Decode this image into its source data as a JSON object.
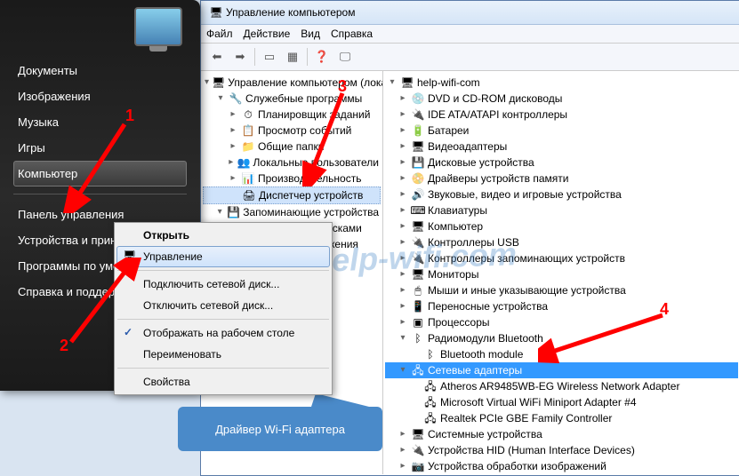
{
  "start_menu": {
    "items": [
      "Документы",
      "Изображения",
      "Музыка",
      "Игры",
      "Компьютер",
      "Панель управления",
      "Устройства и принтеры",
      "Программы по умолчанию",
      "Справка и поддержка"
    ],
    "selected_index": 4,
    "separator_before": [
      5
    ]
  },
  "context_menu": {
    "items": [
      {
        "label": "Открыть",
        "bold": true
      },
      {
        "label": "Управление",
        "highlighted": true,
        "has_icon": true
      },
      {
        "sep": true
      },
      {
        "label": "Подключить сетевой диск..."
      },
      {
        "label": "Отключить сетевой диск..."
      },
      {
        "sep": true
      },
      {
        "label": "Отображать на рабочем столе",
        "checked": true
      },
      {
        "label": "Переименовать"
      },
      {
        "sep": true
      },
      {
        "label": "Свойства"
      }
    ]
  },
  "mgmt": {
    "title": "Управление компьютером",
    "menu": [
      "Файл",
      "Действие",
      "Вид",
      "Справка"
    ],
    "left_tree": [
      {
        "label": "Управление компьютером (локальным)",
        "icon": "🖥",
        "exp": "▾",
        "indent": 0
      },
      {
        "label": "Служебные программы",
        "icon": "🔧",
        "exp": "▾",
        "indent": 1
      },
      {
        "label": "Планировщик заданий",
        "icon": "⏱",
        "exp": "▸",
        "indent": 2
      },
      {
        "label": "Просмотр событий",
        "icon": "📋",
        "exp": "▸",
        "indent": 2
      },
      {
        "label": "Общие папки",
        "icon": "📁",
        "exp": "▸",
        "indent": 2
      },
      {
        "label": "Локальные пользователи",
        "icon": "👥",
        "exp": "▸",
        "indent": 2
      },
      {
        "label": "Производительность",
        "icon": "📊",
        "exp": "▸",
        "indent": 2
      },
      {
        "label": "Диспетчер устройств",
        "icon": "🖨",
        "exp": "",
        "indent": 2,
        "selected": true
      },
      {
        "label": "Запоминающие устройства",
        "icon": "💾",
        "exp": "▾",
        "indent": 1
      },
      {
        "label": "Управление дисками",
        "icon": "💿",
        "exp": "",
        "indent": 2
      },
      {
        "label": "Службы и приложения",
        "icon": "⚙",
        "exp": "▸",
        "indent": 1
      }
    ],
    "right_tree": [
      {
        "label": "help-wifi-com",
        "icon": "🖥",
        "exp": "▾",
        "indent": 0
      },
      {
        "label": "DVD и CD-ROM дисководы",
        "icon": "💿",
        "exp": "▸",
        "indent": 1
      },
      {
        "label": "IDE ATA/ATAPI контроллеры",
        "icon": "🔌",
        "exp": "▸",
        "indent": 1
      },
      {
        "label": "Батареи",
        "icon": "🔋",
        "exp": "▸",
        "indent": 1
      },
      {
        "label": "Видеоадаптеры",
        "icon": "🖥",
        "exp": "▸",
        "indent": 1
      },
      {
        "label": "Дисковые устройства",
        "icon": "💾",
        "exp": "▸",
        "indent": 1
      },
      {
        "label": "Драйверы устройств памяти",
        "icon": "📀",
        "exp": "▸",
        "indent": 1
      },
      {
        "label": "Звуковые, видео и игровые устройства",
        "icon": "🔊",
        "exp": "▸",
        "indent": 1
      },
      {
        "label": "Клавиатуры",
        "icon": "⌨",
        "exp": "▸",
        "indent": 1
      },
      {
        "label": "Компьютер",
        "icon": "🖥",
        "exp": "▸",
        "indent": 1
      },
      {
        "label": "Контроллеры USB",
        "icon": "🔌",
        "exp": "▸",
        "indent": 1
      },
      {
        "label": "Контроллеры запоминающих устройств",
        "icon": "🔌",
        "exp": "▸",
        "indent": 1
      },
      {
        "label": "Мониторы",
        "icon": "🖥",
        "exp": "▸",
        "indent": 1
      },
      {
        "label": "Мыши и иные указывающие устройства",
        "icon": "🖱",
        "exp": "▸",
        "indent": 1
      },
      {
        "label": "Переносные устройства",
        "icon": "📱",
        "exp": "▸",
        "indent": 1
      },
      {
        "label": "Процессоры",
        "icon": "▣",
        "exp": "▸",
        "indent": 1
      },
      {
        "label": "Радиомодули Bluetooth",
        "icon": "ᛒ",
        "exp": "▾",
        "indent": 1
      },
      {
        "label": "Bluetooth module",
        "icon": "ᛒ",
        "exp": "",
        "indent": 2
      },
      {
        "label": "Сетевые адаптеры",
        "icon": "🖧",
        "exp": "▾",
        "indent": 1,
        "selected2": true
      },
      {
        "label": "Atheros AR9485WB-EG Wireless Network Adapter",
        "icon": "🖧",
        "exp": "",
        "indent": 2
      },
      {
        "label": "Microsoft Virtual WiFi Miniport Adapter #4",
        "icon": "🖧",
        "exp": "",
        "indent": 2
      },
      {
        "label": "Realtek PCIe GBE Family Controller",
        "icon": "🖧",
        "exp": "",
        "indent": 2
      },
      {
        "label": "Системные устройства",
        "icon": "🖥",
        "exp": "▸",
        "indent": 1
      },
      {
        "label": "Устройства HID (Human Interface Devices)",
        "icon": "🔌",
        "exp": "▸",
        "indent": 1
      },
      {
        "label": "Устройства обработки изображений",
        "icon": "📷",
        "exp": "▸",
        "indent": 1
      }
    ]
  },
  "annotations": {
    "labels": [
      "1",
      "2",
      "3",
      "4"
    ],
    "callout": "Драйвер Wi-Fi адаптера",
    "watermark": "help-wifi.com"
  }
}
